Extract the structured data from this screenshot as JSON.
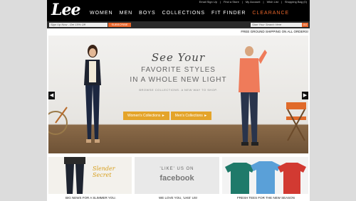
{
  "header": {
    "logo": "Lee",
    "utility_links": [
      "Email Sign Up",
      "Find a Store",
      "My Account",
      "Wish List",
      "Shopping Bag (0)"
    ],
    "nav": [
      "WOMEN",
      "MEN",
      "BOYS",
      "COLLECTIONS",
      "FIT FINDER",
      "CLEARANCE"
    ]
  },
  "subbar": {
    "signup_placeholder": "Sign Up Now - Get 15% Off",
    "subscribe_label": "SUBSCRIBE",
    "search_placeholder": "Start Your Search Here",
    "go_label": "GO",
    "shipping": "FREE GROUND SHIPPING ON ALL ORDERS!"
  },
  "hero": {
    "see_your": "See Your",
    "favorite": "FAVORITE STYLES",
    "whole_new": "IN A WHOLE NEW LIGHT",
    "browse": "BROWSE COLLECTIONS. A NEW WAY TO SHOP.",
    "women_btn": "Women's Collections ►",
    "men_btn": "Men's Collections ►",
    "prev": "◀",
    "next": "▶"
  },
  "tiles": {
    "slender_1": "Slender",
    "slender_2": "Secret",
    "like_us": "'LIKE' US ON",
    "facebook": "facebook",
    "caption_1": "BIG NEWS FOR A SLIMMER YOU.",
    "caption_2": "WE LOVE YOU, 'LIKE' US!",
    "caption_3": "FRESH TEES FOR THE NEW SEASON"
  },
  "colors": {
    "accent": "#e8652a",
    "button": "#e4a42a",
    "topbar": "#000000"
  }
}
